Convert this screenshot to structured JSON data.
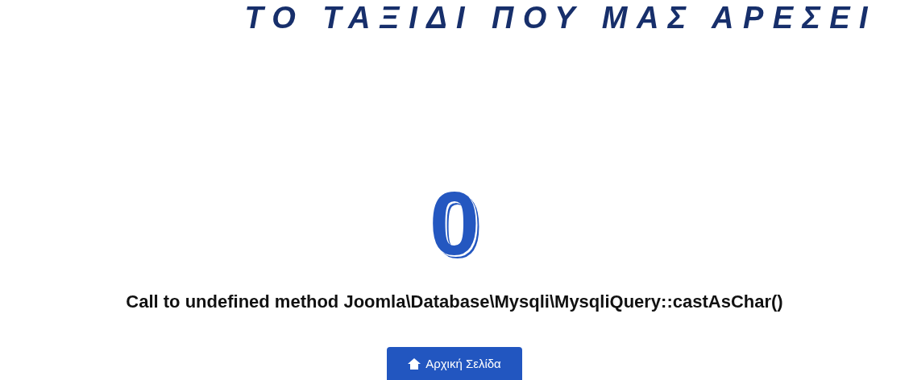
{
  "header": {
    "tagline": "ΤΟ ΤΑΞΙΔΙ ΠΟΥ ΜΑΣ ΑΡΕΣΕΙ"
  },
  "error": {
    "code": "0",
    "message": "Call to undefined method Joomla\\Database\\Mysqli\\MysqliQuery::castAsChar()"
  },
  "home_button": {
    "label": "Αρχική Σελίδα"
  }
}
